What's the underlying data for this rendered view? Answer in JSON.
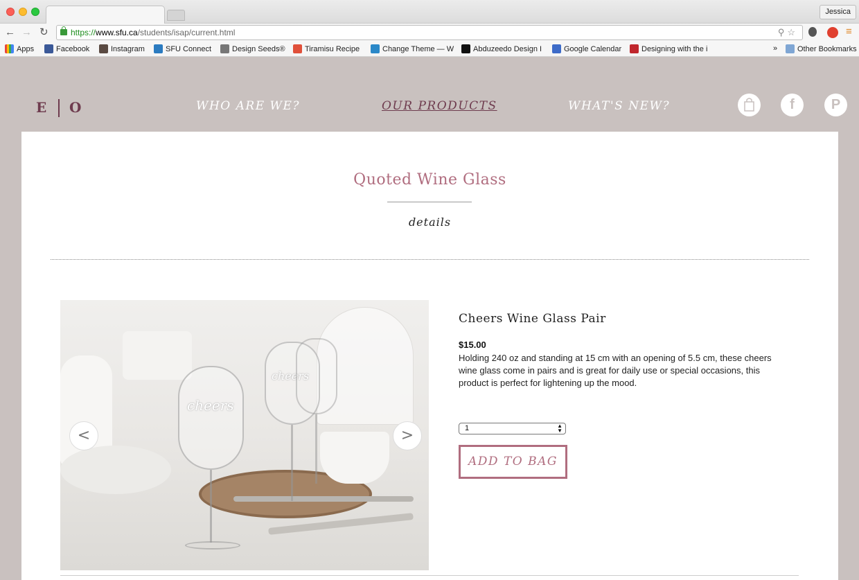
{
  "browser": {
    "user_name": "Jessica",
    "url": {
      "protocol": "https://",
      "host": "www.sfu.ca",
      "path": "/students/isap/current.html"
    },
    "bookmarks": [
      {
        "label": "Apps",
        "color": "#e8453c"
      },
      {
        "label": "Facebook",
        "color": "#3b5998"
      },
      {
        "label": "Instagram",
        "color": "#5a4a42"
      },
      {
        "label": "SFU Connect",
        "color": "#2b7bc0"
      },
      {
        "label": "Design Seeds®",
        "color": "#777777"
      },
      {
        "label": "Tiramisu Recipe",
        "color": "#e0503a"
      },
      {
        "label": "Change Theme — W",
        "color": "#2b88c8"
      },
      {
        "label": "Abduzeedo Design I",
        "color": "#111111"
      },
      {
        "label": "Google Calendar",
        "color": "#3d6bc8"
      },
      {
        "label": "Designing with the i",
        "color": "#c0272d"
      }
    ],
    "bookmarks_more": "»",
    "other_bookmarks": "Other Bookmarks"
  },
  "header": {
    "logo_left": "E",
    "logo_right": "O",
    "nav": [
      {
        "label": "WHO ARE WE?",
        "active": false
      },
      {
        "label": "OUR PRODUCTS",
        "active": true
      },
      {
        "label": "WHAT'S NEW?",
        "active": false
      }
    ],
    "social_facebook": "f",
    "social_pinterest": "P"
  },
  "page": {
    "title": "Quoted Wine Glass",
    "subtitle": "details"
  },
  "gallery": {
    "prev": "<",
    "next": ">",
    "etched_text": "cheers"
  },
  "product": {
    "name": "Cheers Wine Glass Pair",
    "price": "$15.00",
    "description": "Holding 240 oz and standing at 15 cm with an opening of 5.5 cm, these cheers wine glass come in pairs and is great for daily use or special occasions, this product is perfect for lightening up the mood.",
    "quantity": "1",
    "add_to_bag": "ADD TO BAG"
  },
  "colors": {
    "accent": "#b06d7f",
    "logo": "#6e3b4e",
    "background": "#c9c1bf"
  }
}
